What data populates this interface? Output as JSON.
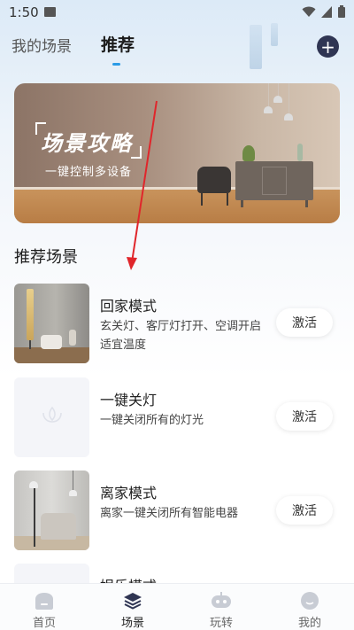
{
  "status_bar": {
    "time": "1:50",
    "icons": [
      "image-icon",
      "wifi-icon",
      "signal-icon",
      "battery-icon"
    ]
  },
  "top_tabs": [
    {
      "label": "我的场景",
      "active": false
    },
    {
      "label": "推荐",
      "active": true
    }
  ],
  "add_button": {
    "label": "+"
  },
  "banner": {
    "title": "场景攻略",
    "subtitle": "一键控制多设备"
  },
  "section": {
    "title": "推荐场景"
  },
  "scenes": [
    {
      "name": "回家模式",
      "description": "玄关灯、客厅灯打开、空调开启适宜温度",
      "action": "激活"
    },
    {
      "name": "一键关灯",
      "description": "一键关闭所有的灯光",
      "action": "激活"
    },
    {
      "name": "离家模式",
      "description": "离家一键关闭所有智能电器",
      "action": "激活"
    },
    {
      "name": "娱乐模式",
      "description": "",
      "action": ""
    }
  ],
  "bottom_nav": [
    {
      "label": "首页",
      "icon": "home-icon",
      "active": false
    },
    {
      "label": "场景",
      "icon": "layers-icon",
      "active": true
    },
    {
      "label": "玩转",
      "icon": "gamepad-icon",
      "active": false
    },
    {
      "label": "我的",
      "icon": "profile-icon",
      "active": false
    }
  ],
  "colors": {
    "accent": "#2b9be6",
    "add_button_bg": "#2f3553",
    "annotation_arrow": "#e0262b"
  }
}
